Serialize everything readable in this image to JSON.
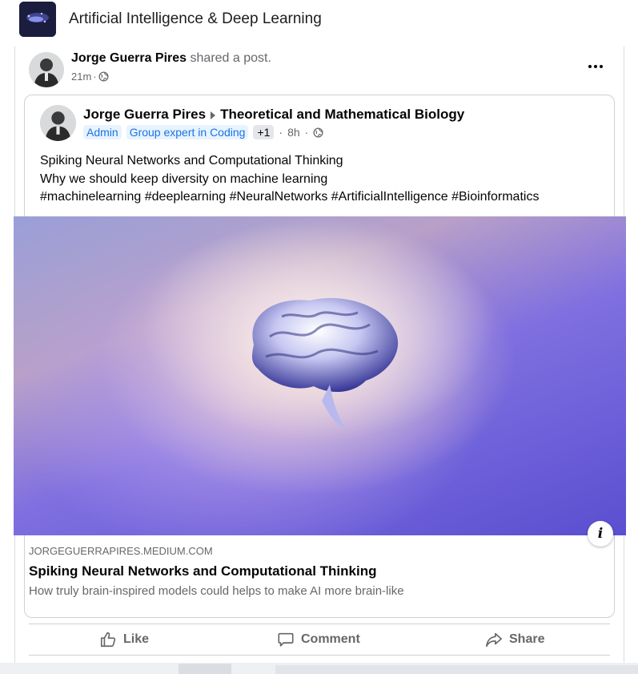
{
  "group": {
    "title": "Artificial Intelligence & Deep Learning"
  },
  "post": {
    "sharer_name": "Jorge Guerra Pires",
    "action_text": "shared a post.",
    "time": "21m",
    "audience_icon": "globe-icon"
  },
  "shared": {
    "author_name": "Jorge Guerra Pires",
    "group_name": "Theoretical and Mathematical Biology",
    "badges": [
      "Admin",
      "Group expert in Coding"
    ],
    "extra_badges": "+1",
    "time": "8h",
    "text_lines": [
      "Spiking Neural Networks and Computational Thinking",
      "Why we should keep diversity on machine learning",
      "#machinelearning #deeplearning #NeuralNetworks #ArtificialIntelligence #Bioinformatics"
    ]
  },
  "link": {
    "domain": "JORGEGUERRAPIRES.MEDIUM.COM",
    "title": "Spiking Neural Networks and Computational Thinking",
    "description": "How truly brain-inspired models could helps to make AI more brain-like",
    "info_label": "i"
  },
  "actions": {
    "like": "Like",
    "comment": "Comment",
    "share": "Share"
  },
  "colors": {
    "link_blue": "#1b74e4",
    "secondary_text": "#65676b",
    "primary_text": "#050505"
  }
}
